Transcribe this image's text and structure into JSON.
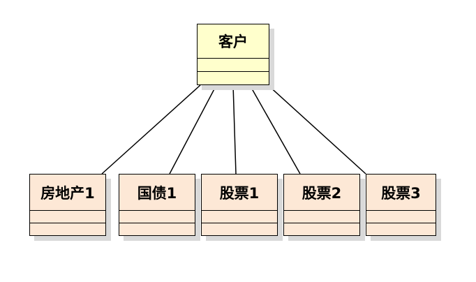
{
  "diagram": {
    "client": {
      "name": "客户"
    },
    "assets": [
      {
        "name": "房地产1"
      },
      {
        "name": "国债1"
      },
      {
        "name": "股票1"
      },
      {
        "name": "股票2"
      },
      {
        "name": "股票3"
      }
    ],
    "colors": {
      "client_fill": "#ffffcc",
      "asset_fill": "#fde8d6",
      "line": "#000000",
      "shadow": "#d9d9d9"
    }
  }
}
